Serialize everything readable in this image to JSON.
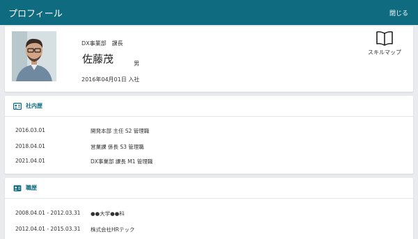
{
  "header": {
    "title": "プロフィール",
    "close_label": "閉じる"
  },
  "profile": {
    "department": "DX事業部　課長",
    "name": "佐藤茂",
    "gender": "男",
    "joined": "2016年04月01日 入社",
    "skillmap_label": "スキルマップ"
  },
  "history": {
    "title": "社内歴",
    "rows": [
      {
        "date": "2016.03.01",
        "desc": "開発本部 主任 S2 管理職"
      },
      {
        "date": "2018.04.01",
        "desc": "営業課 係長 S3 管理職"
      },
      {
        "date": "2021.04.01",
        "desc": "DX事業部 課長 M1 管理職"
      }
    ]
  },
  "career": {
    "title": "職歴",
    "rows": [
      {
        "date": "2008.04.01 - 2012.03.31",
        "desc": "●●大学●●科"
      },
      {
        "date": "2012.04.01 - 2015.03.31",
        "desc": "株式会社HRテック"
      }
    ]
  },
  "colors": {
    "header_bg": "#0f6b7f",
    "section_title": "#0f6b7f",
    "page_bg": "#e9ebee"
  }
}
